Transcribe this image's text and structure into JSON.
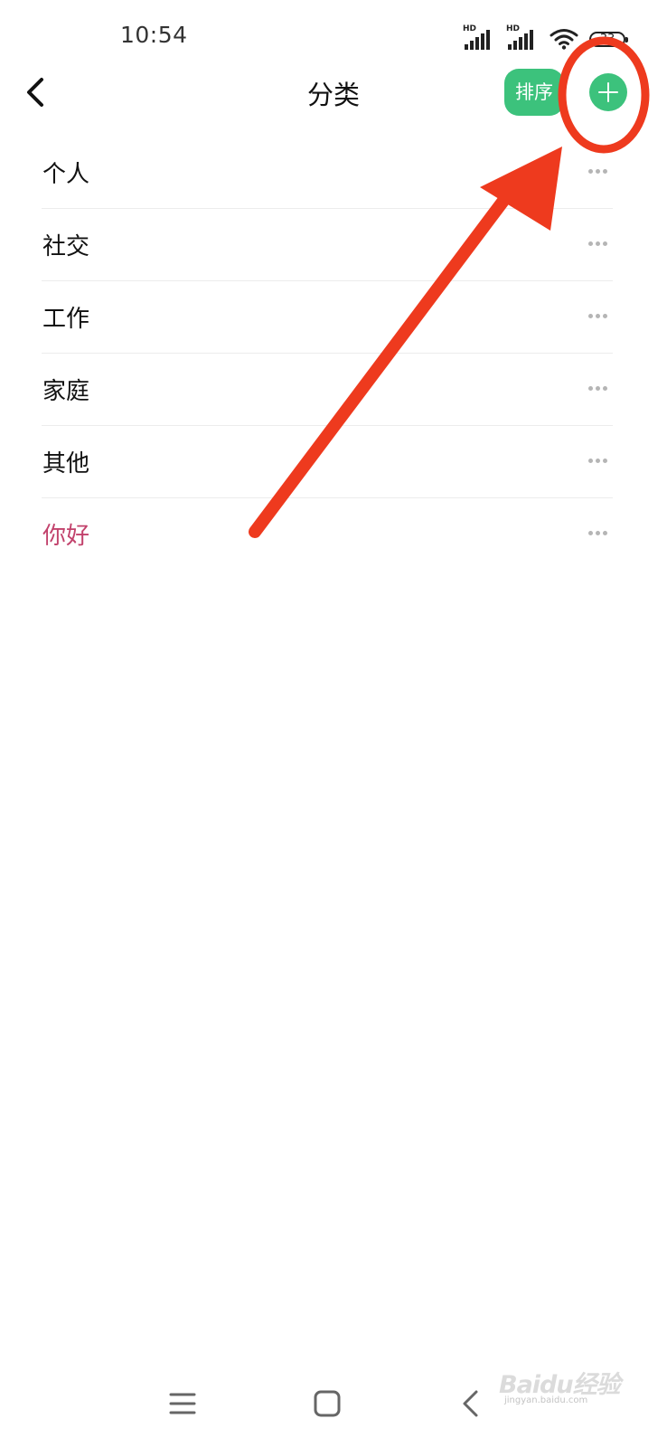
{
  "status_bar": {
    "time": "10:54",
    "signal_1_label": "HD",
    "signal_2_label": "HD",
    "battery": "33",
    "icons": [
      "signal-hd-icon",
      "signal-hd-icon",
      "wifi-icon",
      "battery-icon"
    ]
  },
  "header": {
    "back_icon": "chevron-left-icon",
    "title": "分类",
    "sort_label": "排序",
    "add_icon": "plus-icon"
  },
  "categories": [
    {
      "label": "个人",
      "menu_icon": "more-horizontal-icon"
    },
    {
      "label": "社交",
      "menu_icon": "more-horizontal-icon"
    },
    {
      "label": "工作",
      "menu_icon": "more-horizontal-icon"
    },
    {
      "label": "家庭",
      "menu_icon": "more-horizontal-icon"
    },
    {
      "label": "其他",
      "menu_icon": "more-horizontal-icon"
    },
    {
      "label": "你好",
      "menu_icon": "more-horizontal-icon",
      "color": "#c2426c"
    }
  ],
  "nav_bar": {
    "icons": [
      "menu-icon",
      "home-square-icon",
      "back-chevron-icon"
    ]
  },
  "watermark": {
    "text": "Baidu经验",
    "sub": "jingyan.baidu.com"
  },
  "colors": {
    "accent_green": "#3cc27c",
    "annotation_red": "#ee3a1e",
    "highlight_pink": "#c2426c"
  }
}
